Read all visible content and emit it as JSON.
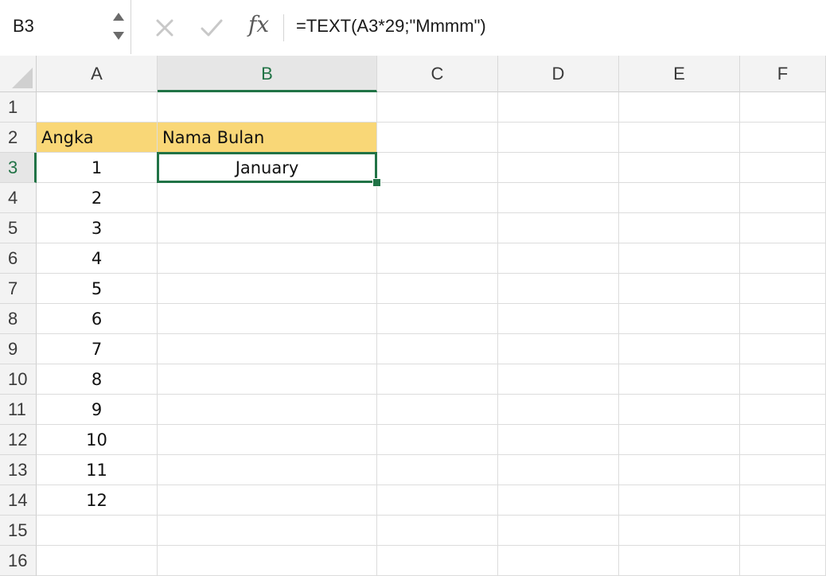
{
  "formula_bar": {
    "name_box": "B3",
    "fx_label": "fx",
    "formula": "=TEXT(A3*29;\"Mmmm\")"
  },
  "columns": [
    "A",
    "B",
    "C",
    "D",
    "E",
    "F"
  ],
  "rows": [
    "1",
    "2",
    "3",
    "4",
    "5",
    "6",
    "7",
    "8",
    "9",
    "10",
    "11",
    "12",
    "13",
    "14",
    "15",
    "16"
  ],
  "selected_cell": "B3",
  "cells": {
    "A2": "Angka",
    "B2": "Nama Bulan",
    "A3": "1",
    "B3": "January",
    "A4": "2",
    "A5": "3",
    "A6": "4",
    "A7": "5",
    "A8": "6",
    "A9": "7",
    "A10": "8",
    "A11": "9",
    "A12": "10",
    "A13": "11",
    "A14": "12"
  },
  "colors": {
    "accent": "#217346",
    "header_fill": "#f9d777"
  }
}
